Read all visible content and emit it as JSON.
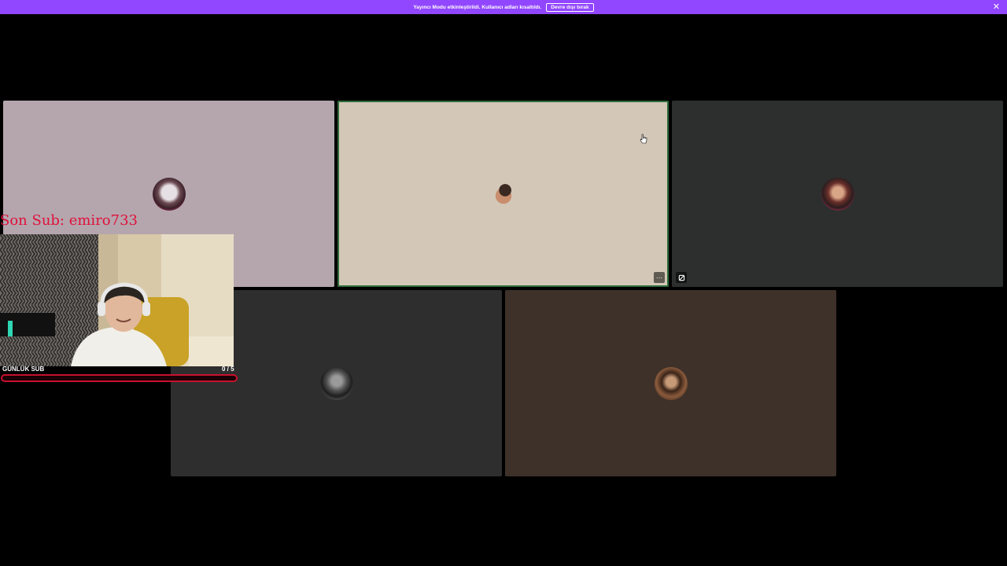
{
  "banner": {
    "message": "Yayıncı Modu etkinleştirildi. Kullanıcı adları kısaltıldı.",
    "disable_button": "Devre dışı bırak",
    "close_icon": "close-icon",
    "background": "#9146ff"
  },
  "tiles": [
    {
      "background": "#b5a6ae",
      "state": "idle"
    },
    {
      "background": "#d3c7b7",
      "state": "active-speaker",
      "border": "#2e6b3a",
      "more_icon": "more-options-icon"
    },
    {
      "background": "#2c2f2e",
      "state": "idle",
      "icon": "activity-icon"
    },
    {
      "background": "#2e2e2e",
      "state": "idle"
    },
    {
      "background": "#3e3129",
      "state": "idle"
    }
  ],
  "overlay": {
    "last_sub_label": "Son Sub: emiro733",
    "goal_label": "GÜNLÜK SUB",
    "goal_count": "0  / 5",
    "goal_progress": 0,
    "accent": "#e0103a"
  }
}
